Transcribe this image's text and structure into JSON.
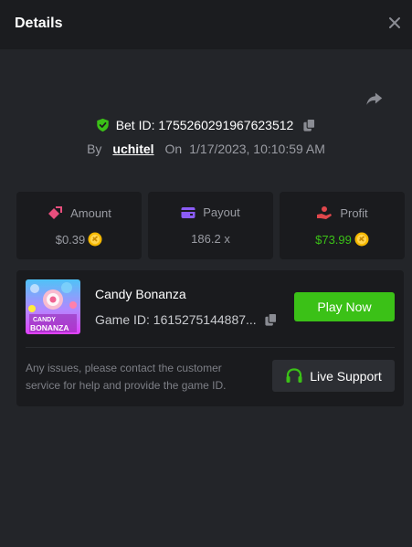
{
  "header": {
    "title": "Details"
  },
  "bet": {
    "label": "Bet ID:",
    "id": "1755260291967623512"
  },
  "byline": {
    "by": "By",
    "user": "uchitel",
    "on": "On",
    "datetime": "1/17/2023, 10:10:59 AM"
  },
  "stats": {
    "amount": {
      "label": "Amount",
      "value": "$0.39"
    },
    "payout": {
      "label": "Payout",
      "value": "186.2 x"
    },
    "profit": {
      "label": "Profit",
      "value": "$73.99"
    }
  },
  "game": {
    "name": "Candy Bonanza",
    "id_label": "Game ID:",
    "id": "1615275144887...",
    "thumb_text": [
      "CANDY",
      "BONANZA"
    ],
    "play_label": "Play Now",
    "issues_text": "Any issues, please contact the customer service for help and provide the game ID.",
    "support_label": "Live Support"
  },
  "colors": {
    "accent_green": "#3bc117",
    "profit_green": "#3bc117",
    "amount_icon": "#e84f7d",
    "payout_icon": "#8b5cf6",
    "profit_icon": "#e0474c",
    "coin": "#f5b800"
  },
  "icons": [
    "close-icon",
    "share-icon",
    "shield-check-icon",
    "copy-icon",
    "amount-icon",
    "wallet-icon",
    "profit-hand-icon",
    "coin-icon",
    "headset-icon"
  ]
}
